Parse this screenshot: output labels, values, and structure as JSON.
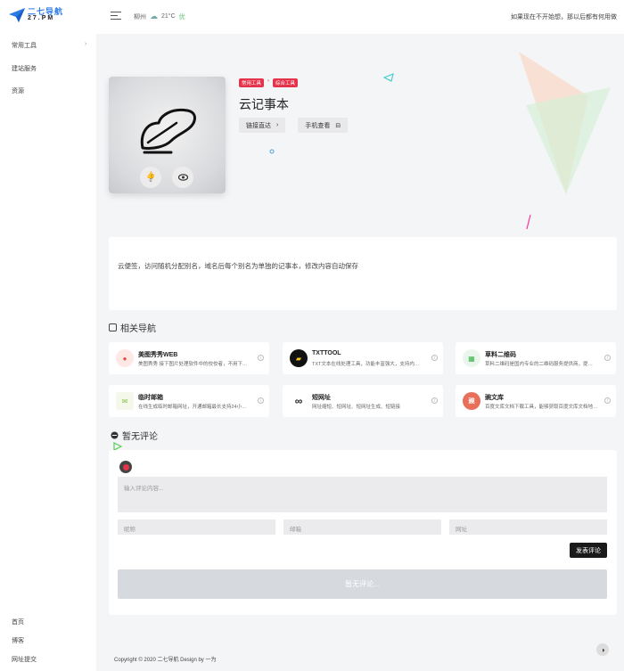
{
  "logo": {
    "line1": "二七导航",
    "line2": "27.PM"
  },
  "topbar": {
    "city": "柳州",
    "temp": "21°C",
    "aqi": "优",
    "greeting": "如果现在不开始想，那以后都有何用做"
  },
  "sidebar": {
    "items": [
      {
        "label": "常用工具",
        "chevron": "›"
      },
      {
        "label": "建站服务"
      },
      {
        "label": "资源"
      }
    ],
    "bottom": [
      {
        "label": "首页"
      },
      {
        "label": "博客"
      },
      {
        "label": "网址提交"
      }
    ]
  },
  "app": {
    "tags": [
      "常用工具",
      "综合工具"
    ],
    "tag_sep": "›",
    "title": "云记事本",
    "like_count": "0",
    "btn_link": "链接直达",
    "btn_link_icon": "›",
    "btn_mobile": "手机查看",
    "btn_mobile_icon": "⊟"
  },
  "description": "云便签，访问随机分配别名，域名后每个别名为单独的记事本，修改内容自动保存",
  "related": {
    "title": "相关导航",
    "items": [
      {
        "name": "美图秀秀WEB",
        "desc": "美图秀秀 接下图片处理软件中的佼佼者，不用下…",
        "icon": "camera-icon",
        "color": "#e84c3d",
        "bg": "#fde8e6",
        "glyph": "●"
      },
      {
        "name": "TXTTOOL",
        "desc": "TXT文本在线处理工具，功能丰富强大，支持内…",
        "icon": "txt-tool-icon",
        "color": "#f5c518",
        "bg": "#111",
        "glyph": "▰"
      },
      {
        "name": "草料二维码",
        "desc": "草料二维码是国内专业的二维码服务提供商，提…",
        "icon": "qrcode-icon",
        "color": "#3bb34a",
        "bg": "#eaf6ec",
        "glyph": "▦"
      },
      {
        "name": "临时邮箱",
        "desc": "在线生成临时邮箱网址，开通邮箱最长支持24小…",
        "icon": "mail-icon",
        "color": "#8bc34a",
        "bg": "#f3f8ea",
        "glyph": "✉"
      },
      {
        "name": "短网址",
        "desc": "网址缩短、短网址、短网址生成、短链接",
        "icon": "link-icon",
        "color": "#222",
        "bg": "#fff",
        "glyph": "∞"
      },
      {
        "name": "豌文库",
        "desc": "百度文库文档下载工具，能够获取百度文库文档地…",
        "icon": "doc-library-icon",
        "color": "#fff",
        "bg": "#e8705b",
        "glyph": "豌"
      }
    ],
    "info_glyph": "i"
  },
  "comments": {
    "title": "暂无评论",
    "textarea_placeholder": "输入评论内容...",
    "name_placeholder": "昵称",
    "email_placeholder": "邮箱",
    "url_placeholder": "网址",
    "submit": "发表评论",
    "empty": "暂无评论..."
  },
  "footer": {
    "text": "Copyright © 2020 二七导航   Design by 一为"
  },
  "colors": {
    "tag": "#e5334b",
    "accent": "#2c7be5"
  }
}
